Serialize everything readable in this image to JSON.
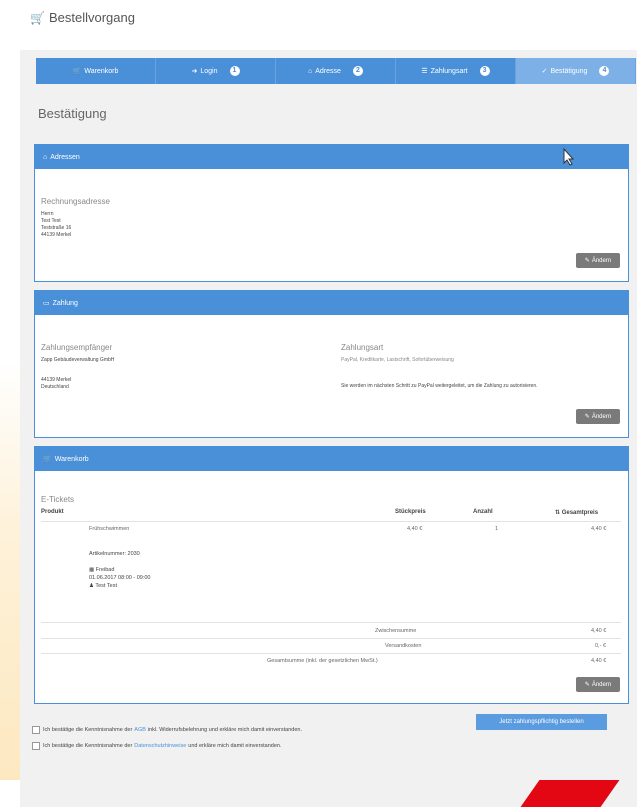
{
  "header": {
    "title": "Bestellvorgang",
    "icon": "shopping-cart-icon"
  },
  "steps": [
    {
      "label": "Warenkorb",
      "icon": "cart-icon",
      "num": ""
    },
    {
      "label": "Login",
      "icon": "sign-in-icon",
      "num": "1"
    },
    {
      "label": "Adresse",
      "icon": "home-icon",
      "num": "2"
    },
    {
      "label": "Zahlungsart",
      "icon": "list-icon",
      "num": "3"
    },
    {
      "label": "Bestätigung",
      "icon": "check-icon",
      "num": "4"
    }
  ],
  "main": {
    "heading": "Bestätigung"
  },
  "address": {
    "panel_title": "Adressen",
    "subtitle": "Rechnungsadresse",
    "lines": [
      "Herrn",
      "Test Test",
      "Teststraße 16",
      "44139 Merkel"
    ],
    "edit_label": "Ändern"
  },
  "payment": {
    "panel_title": "Zahlung",
    "recipient_title": "Zahlungsempfänger",
    "recipient_lines": [
      "Zapp Gebäudeverwaltung GmbH",
      "",
      "44139 Merkel",
      "Deutschland"
    ],
    "method_title": "Zahlungsart",
    "method_desc": "PayPal, Kreditkarte, Lastschrift, Sofortüberweisung",
    "note": "Sie werden im nächsten Schritt zu PayPal weitergeleitet, um die Zahlung zu autorisieren.",
    "edit_label": "Ändern"
  },
  "order": {
    "panel_title": "Warenkorb",
    "subtitle": "E-Tickets",
    "columns": {
      "product": "Produkt",
      "unit_price": "Stückpreis",
      "quantity": "Anzahl",
      "total": "Gesamtpreis"
    },
    "item": {
      "name": "Frühschwimmen",
      "unit_price": "4,40 €",
      "quantity": "1",
      "total": "4,40 €",
      "article": "Artikelnummer: 2030",
      "detail_1": "Freibad",
      "detail_2": "01.06.2017 08:00 - 09:00",
      "detail_3": "Test Test"
    },
    "subtotal_label": "Zwischensumme",
    "subtotal_value": "4,40 €",
    "shipping_label": "Versandkosten",
    "shipping_value": "0,- €",
    "grand_label": "Gesamtsumme (inkl. der gesetzlichen MwSt.)",
    "grand_value": "4,40 €",
    "edit_label": "Ändern"
  },
  "checks": [
    {
      "pre": "Ich bestätige die Kenntnisnahme der",
      "link": "AGB",
      "post": "inkl. Widerrufsbelehrung und erkläre mich damit einverstanden."
    },
    {
      "pre": "Ich bestätige die Kenntnisnahme der",
      "link": "Datenschutzhinweise",
      "post": "und erkläre mich damit einverstanden."
    }
  ],
  "submit_label": "Jetzt zahlungspflichtig bestellen",
  "colors": {
    "accent": "#4a90d9",
    "edit_button": "#7a7a7a"
  }
}
